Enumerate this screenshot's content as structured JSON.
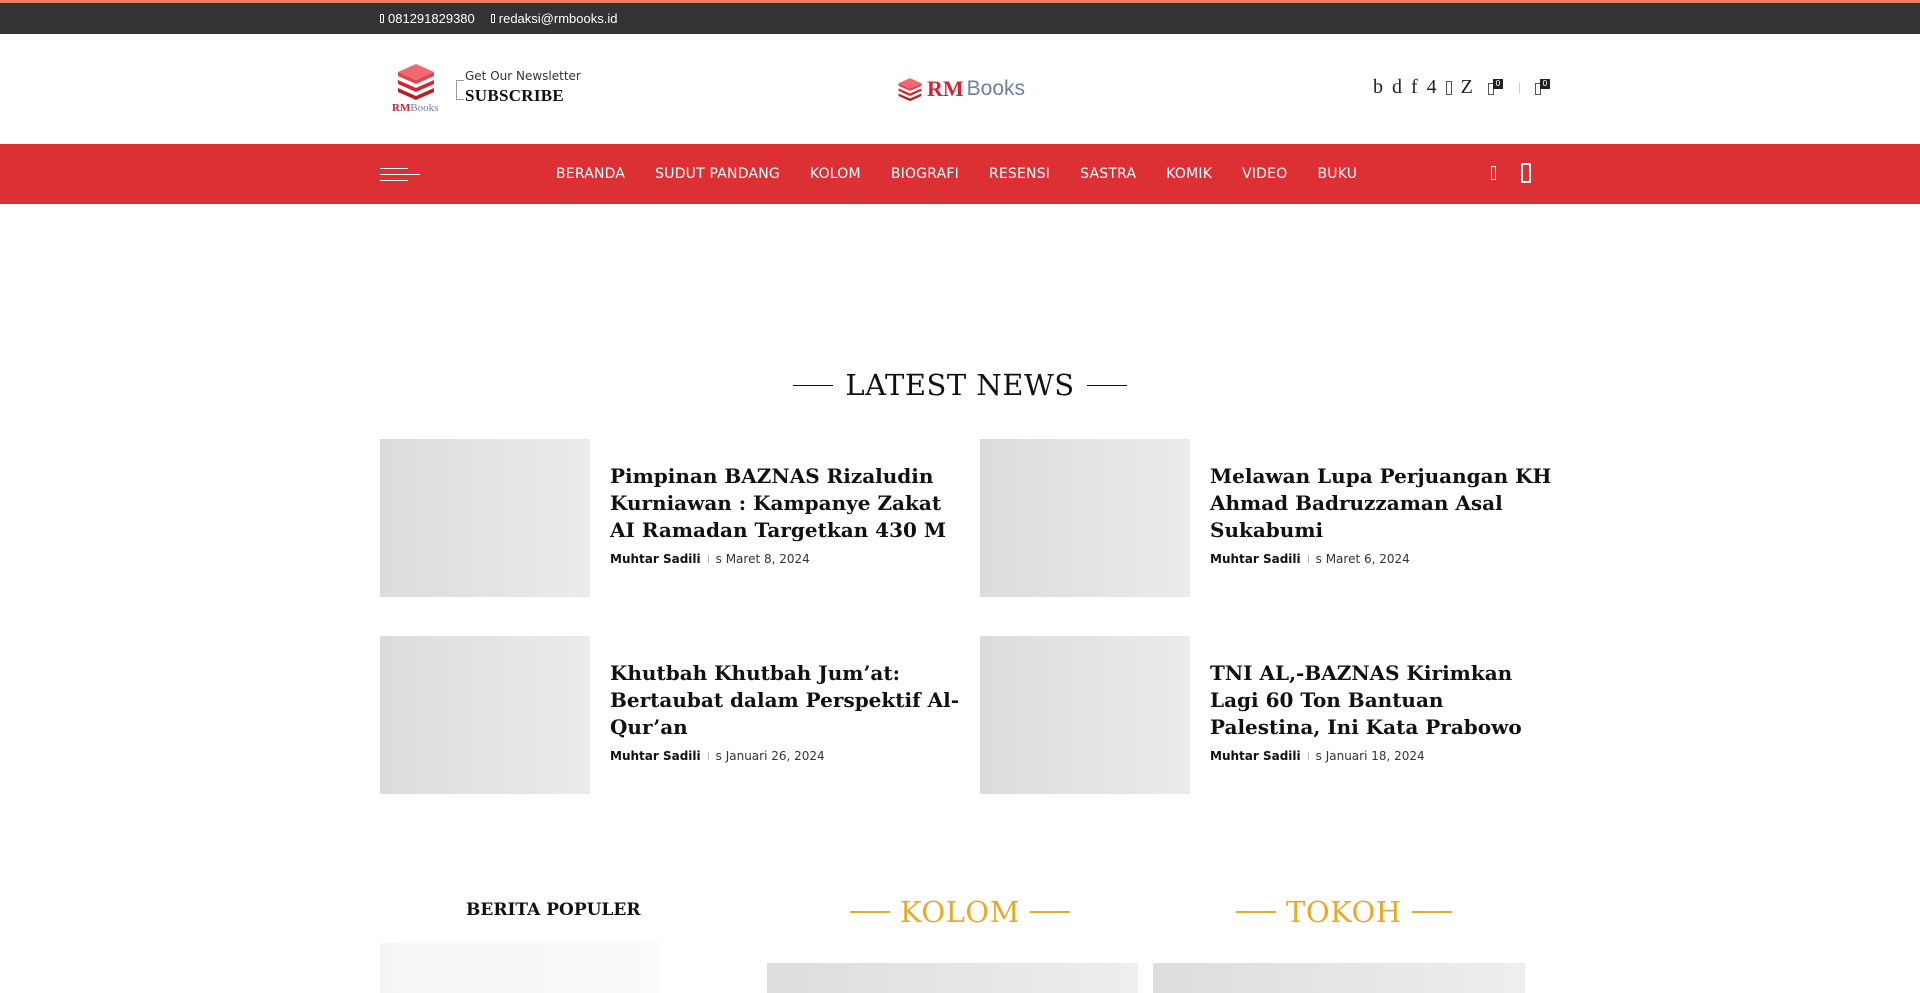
{
  "topbar": {
    "phone": "081291829380",
    "email": "redaksi@rmbooks.id"
  },
  "header": {
    "logo_small": {
      "rm": "RM",
      "books": "Books"
    },
    "newsletter": {
      "small": "Get Our Newsletter",
      "big": "SUBSCRIBE"
    },
    "logo_main": {
      "rm": "RM",
      "books": "Books"
    },
    "social": [
      "b",
      "d",
      "f",
      "4",
      "",
      "Z"
    ],
    "wishlist_count": "0",
    "cart_count": "0"
  },
  "nav": {
    "items": [
      "BERANDA",
      "SUDUT PANDANG",
      "KOLOM",
      "BIOGRAFI",
      "RESENSI",
      "SASTRA",
      "KOMIK",
      "VIDEO",
      "BUKU"
    ]
  },
  "latest": {
    "title": "LATEST NEWS",
    "posts": [
      {
        "title": "Pimpinan BAZNAS Rizaludin Kurniawan : Kampanye Zakat AI Ramadan Targetkan 430 M",
        "author": "Muhtar Sadili",
        "date": "s Maret 8, 2024"
      },
      {
        "title": "Melawan Lupa Perjuangan KH Ahmad Badruzzaman Asal Sukabumi",
        "author": "Muhtar Sadili",
        "date": "s Maret 6, 2024"
      },
      {
        "title": "Khutbah Khutbah Jum’at: Bertaubat dalam Perspektif Al-Qur’an",
        "author": "Muhtar Sadili",
        "date": "s Januari 26, 2024"
      },
      {
        "title": "TNI AL,-BAZNAS Kirimkan Lagi 60 Ton Bantuan Palestina, Ini Kata Prabowo",
        "author": "Muhtar Sadili",
        "date": "s Januari 18, 2024"
      }
    ]
  },
  "bottom": {
    "populer": "BERITA POPULER",
    "kolom": "KOLOM",
    "tokoh": "TOKOH"
  },
  "colors": {
    "topbar": "#333333",
    "nav": "#dc3035",
    "gold": "#e8a92b",
    "brand_red": "#d5232f",
    "brand_blue": "#6b7fa6"
  }
}
